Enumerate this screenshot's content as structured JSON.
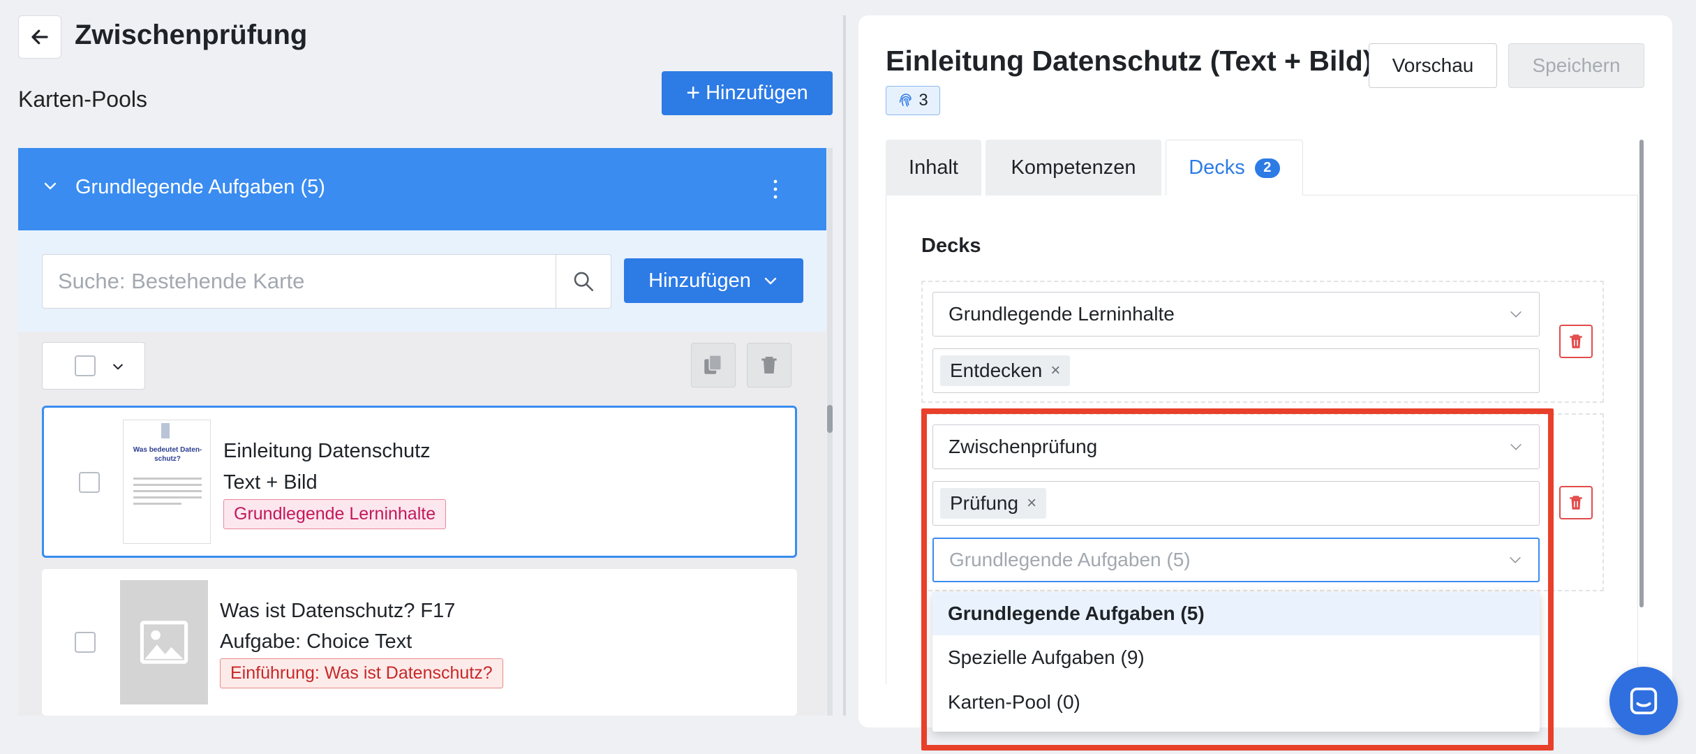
{
  "header": {
    "title": "Zwischenprüfung"
  },
  "left_panel": {
    "pools_title": "Karten-Pools",
    "add_pool_label": "Hinzufügen",
    "pool": {
      "name": "Grundlegende Aufgaben (5)"
    },
    "search": {
      "placeholder": "Suche: Bestehende Karte"
    },
    "add_card_label": "Hinzufügen",
    "cards": [
      {
        "title": "Einleitung Datenschutz",
        "subtitle": "Text + Bild",
        "tag": "Grundlegende Lerninhalte",
        "thumb_title": "Was bedeutet Daten-schutz?"
      },
      {
        "title": "Was ist Datenschutz? F17",
        "subtitle": "Aufgabe: Choice Text",
        "tag": "Einführung: Was ist Datenschutz?"
      }
    ]
  },
  "editor": {
    "title": "Einleitung Datenschutz (Text + Bild)",
    "fingerprint_count": "3",
    "preview_label": "Vorschau",
    "save_label": "Speichern",
    "tabs": [
      {
        "label": "Inhalt"
      },
      {
        "label": "Kompetenzen"
      },
      {
        "label": "Decks",
        "count": "2"
      }
    ],
    "decks_heading": "Decks",
    "decks": [
      {
        "select_value": "Grundlegende Lerninhalte",
        "tags": [
          "Entdecken"
        ]
      },
      {
        "select_value": "Zwischenprüfung",
        "tags": [
          "Prüfung"
        ],
        "pool_select_placeholder": "Grundlegende Aufgaben (5)"
      }
    ],
    "pool_options": [
      "Grundlegende Aufgaben (5)",
      "Spezielle Aufgaben (9)",
      "Karten-Pool (0)"
    ]
  },
  "colors": {
    "primary": "#2d7be5",
    "pool_header": "#3a8cf0",
    "highlight": "#e8402a",
    "danger": "#e34b4b"
  },
  "icons": {
    "back": "arrow-left-icon",
    "search": "search-icon",
    "copy": "copy-icon",
    "trash": "trash-icon",
    "fingerprint": "fingerprint-icon",
    "chat": "chat-icon"
  }
}
